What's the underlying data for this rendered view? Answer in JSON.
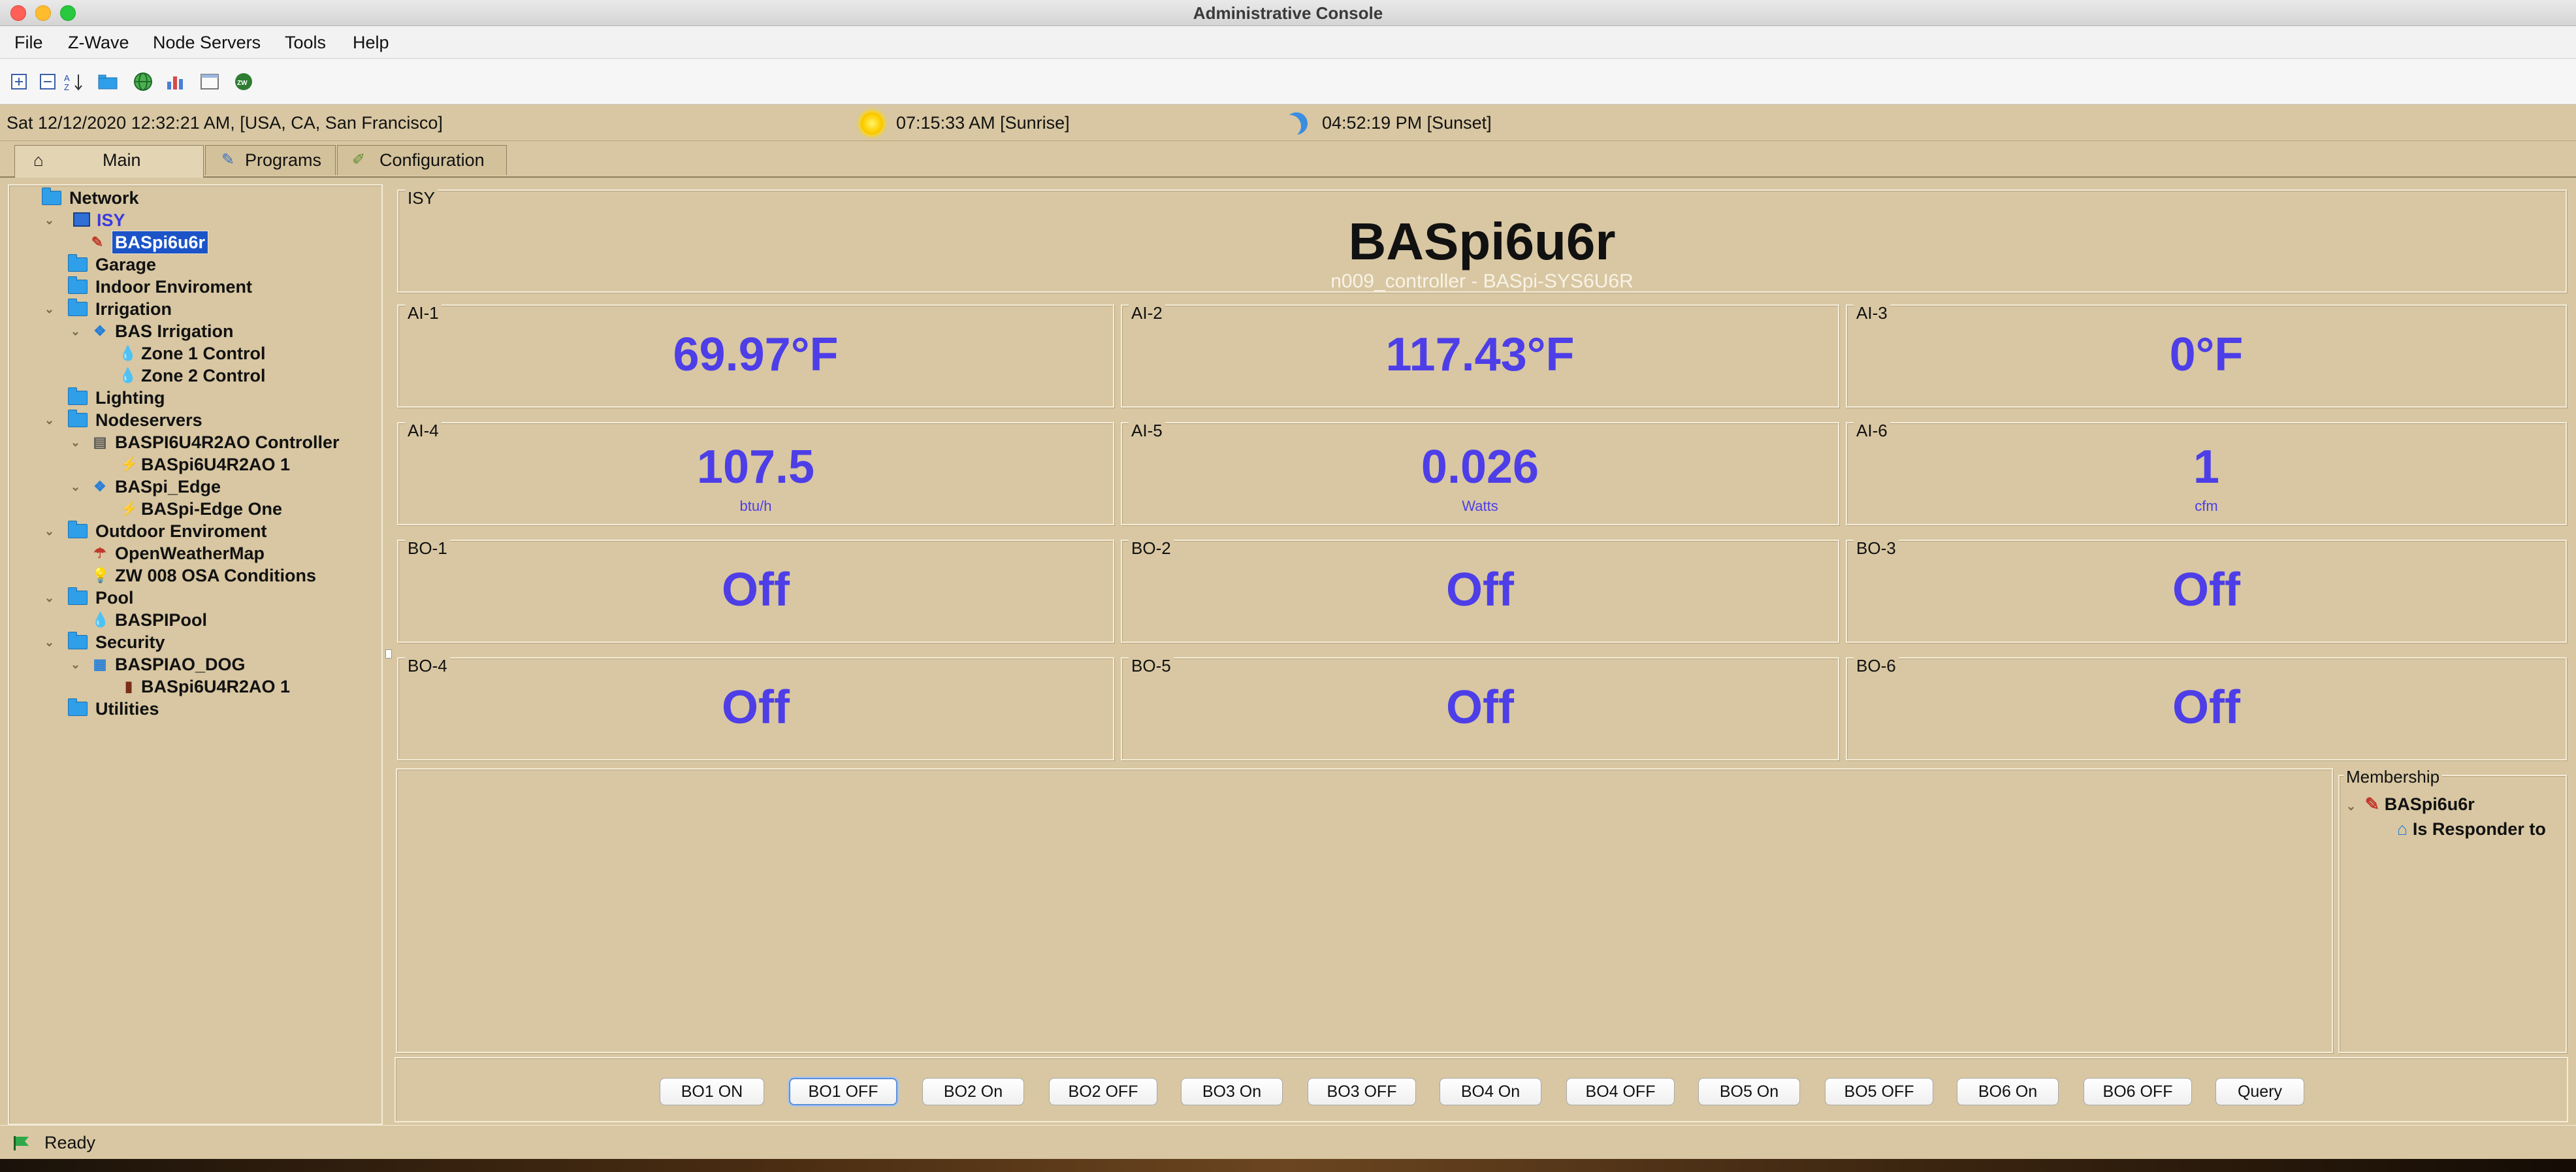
{
  "window": {
    "title": "Administrative Console"
  },
  "menu": [
    "File",
    "Z-Wave",
    "Node Servers",
    "Tools",
    "Help"
  ],
  "toolbar_icons": [
    "expand-all-icon",
    "collapse-all-icon",
    "sort-az-icon",
    "folder-icon",
    "network-globe-icon",
    "chart-icon",
    "window-icon",
    "zwave-icon"
  ],
  "status": {
    "datetime": "Sat 12/12/2020 12:32:21 AM,  [USA, CA, San Francisco]",
    "sunrise": "07:15:33 AM [Sunrise]",
    "sunset": "04:52:19 PM [Sunset]"
  },
  "tabs": [
    {
      "label": "Main",
      "active": true
    },
    {
      "label": "Programs",
      "active": false
    },
    {
      "label": "Configuration",
      "active": false
    }
  ],
  "tree": {
    "network": "Network",
    "isy": "ISY",
    "selected": "BASpi6u6r",
    "garage": "Garage",
    "indoor": "Indoor Enviroment",
    "irrigation": "Irrigation",
    "bas_irrigation": "BAS Irrigation",
    "zone1": "Zone 1 Control",
    "zone2": "Zone 2 Control",
    "lighting": "Lighting",
    "nodeservers": "Nodeservers",
    "controller": "BASPI6U4R2AO Controller",
    "controller_child": "BASpi6U4R2AO 1",
    "edge": "BASpi_Edge",
    "edge_child": "BASpi-Edge One",
    "outdoor": "Outdoor Enviroment",
    "owm": "OpenWeatherMap",
    "zw008": "ZW 008 OSA Conditions",
    "pool": "Pool",
    "baspipool": "BASPIPool",
    "security": "Security",
    "dog": "BASPIAO_DOG",
    "dog_child": "BASpi6U4R2AO 1",
    "utilities": "Utilities"
  },
  "header": {
    "group_label": "ISY",
    "title": "BASpi6u6r",
    "subtitle": "n009_controller - BASpi-SYS6U6R"
  },
  "analog_inputs": [
    {
      "label": "AI-1",
      "value": "69.97°F",
      "unit": ""
    },
    {
      "label": "AI-2",
      "value": "117.43°F",
      "unit": ""
    },
    {
      "label": "AI-3",
      "value": "0°F",
      "unit": ""
    },
    {
      "label": "AI-4",
      "value": "107.5",
      "unit": "btu/h"
    },
    {
      "label": "AI-5",
      "value": "0.026",
      "unit": "Watts"
    },
    {
      "label": "AI-6",
      "value": "1",
      "unit": "cfm"
    }
  ],
  "binary_outputs": [
    {
      "label": "BO-1",
      "value": "Off"
    },
    {
      "label": "BO-2",
      "value": "Off"
    },
    {
      "label": "BO-3",
      "value": "Off"
    },
    {
      "label": "BO-4",
      "value": "Off"
    },
    {
      "label": "BO-5",
      "value": "Off"
    },
    {
      "label": "BO-6",
      "value": "Off"
    }
  ],
  "membership": {
    "label": "Membership",
    "node": "BASpi6u6r",
    "child": "Is Responder to"
  },
  "buttons": [
    "BO1 ON",
    "BO1 OFF",
    "BO2 On",
    "BO2 OFF",
    "BO3 On",
    "BO3 OFF",
    "BO4 On",
    "BO4 OFF",
    "BO5 On",
    "BO5 OFF",
    "BO6 On",
    "BO6 OFF",
    "Query"
  ],
  "footer": {
    "status": "Ready"
  },
  "colors": {
    "panel_bg": "#d8c7a2",
    "value_text": "#4d3ee8",
    "selection": "#1c54c8"
  }
}
